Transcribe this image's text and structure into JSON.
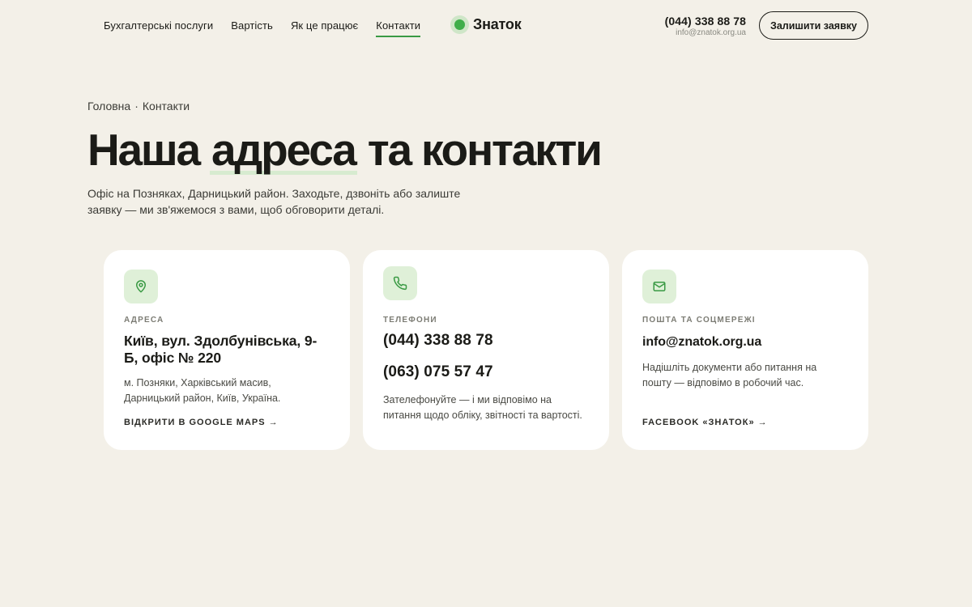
{
  "nav": {
    "items": [
      "Бухгалтерські послуги",
      "Вартість",
      "Як це працює",
      "Контакти"
    ],
    "active_index": 3
  },
  "logo": {
    "text": "Знаток"
  },
  "header_contact": {
    "phone": "(044) 338 88 78",
    "email": "info@znatok.org.ua"
  },
  "cta": {
    "label": "Залишити заявку"
  },
  "breadcrumb": {
    "home": "Головна",
    "separator": "·",
    "current": "Контакти"
  },
  "hero": {
    "title_before": "Наша",
    "title_highlight": "адреса",
    "title_after": "та контакти",
    "lead": "Офіс на Позняках, Дарницький район. Заходьте, дзвоніть або залиште заявку — ми зв'яжемося з вами, щоб обговорити деталі."
  },
  "cards": {
    "address": {
      "icon": "map-pin-icon",
      "label": "Адреса",
      "title": "Київ, вул. Здолбунівська, 9-Б, офіс № 220",
      "desc": "м. Позняки, Харківський масив, Дарницький район, Київ, Україна.",
      "link": "Відкрити в Google Maps →"
    },
    "phones": {
      "icon": "phone-icon",
      "label": "Телефони",
      "phone1": "(044) 338 88 78",
      "phone2": "(063) 075 57 47",
      "desc": "Зателефонуйте — і ми відповімо на питання щодо обліку, звітності та вартості."
    },
    "mail": {
      "icon": "mail-icon",
      "label": "Пошта та соцмережі",
      "title": "info@znatok.org.ua",
      "desc": "Надішліть документи або питання на пошту — відповімо в робочий час.",
      "link": "Facebook «Знаток» →"
    }
  },
  "colors": {
    "background": "#f3f0e8",
    "accent": "#3fae4a",
    "icon_bg": "#dff0d8",
    "text": "#1b1b17"
  }
}
